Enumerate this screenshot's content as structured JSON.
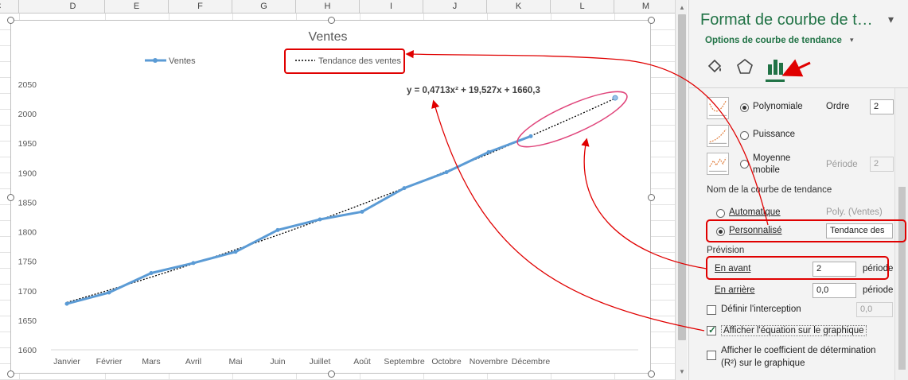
{
  "sheet": {
    "column_headers": [
      "C",
      "D",
      "E",
      "F",
      "G",
      "H",
      "I",
      "J",
      "K",
      "L",
      "M"
    ]
  },
  "chart_data": {
    "type": "line",
    "title": "Ventes",
    "categories": [
      "Janvier",
      "Février",
      "Mars",
      "Avril",
      "Mai",
      "Juin",
      "Juillet",
      "Août",
      "Septembre",
      "Octobre",
      "Novembre",
      "Décembre"
    ],
    "series": [
      {
        "name": "Ventes",
        "values": [
          1678,
          1697,
          1730,
          1747,
          1766,
          1803,
          1821,
          1834,
          1874,
          1901,
          1935,
          1962
        ],
        "color": "#5b9bd5"
      },
      {
        "name": "Tendance des ventes",
        "kind": "trendline",
        "style": "dotted",
        "color": "#000000"
      }
    ],
    "forecast_point": {
      "y": 2027
    },
    "yticks": [
      1600,
      1650,
      1700,
      1750,
      1800,
      1850,
      1900,
      1950,
      2000,
      2050
    ],
    "ylim": [
      1600,
      2050
    ],
    "equation_label": "y = 0,4713x² + 19,527x + 1660,3",
    "legend_position": "top",
    "grid": false
  },
  "pane": {
    "title": "Format de courbe de t…",
    "close": "▾",
    "subtitle": "Options de courbe de tendance",
    "subtitle_caret": "▾",
    "icons": [
      "fill-bucket-icon",
      "pentagon-effects-icon",
      "bar-chart-options-icon"
    ],
    "options": {
      "polynomiale": "Polynomiale",
      "ordre_label": "Ordre",
      "ordre_value": "2",
      "puissance": "Puissance",
      "moyenne_mobile_line1": "Moyenne",
      "moyenne_mobile_line2": "mobile",
      "periode_label": "Période",
      "periode_value": "2"
    },
    "name_section": {
      "heading": "Nom de la courbe de tendance",
      "automatique": "Automatique",
      "automatique_value": "Poly. (Ventes)",
      "personnalise": "Personnalisé",
      "personnalise_value": "Tendance des"
    },
    "forecast_section": {
      "heading": "Prévision",
      "en_avant": "En avant",
      "en_avant_value": "2",
      "en_avant_unit": "période",
      "en_arriere": "En arrière",
      "en_arriere_value": "0,0",
      "en_arriere_unit": "période"
    },
    "intercept": {
      "label": "Définir l'interception",
      "value": "0,0"
    },
    "show_equation": "Afficher l'équation sur le graphique",
    "show_r2_line1": "Afficher le coefficient de détermination",
    "show_r2_line2": "(R²) sur le graphique"
  },
  "colors": {
    "accent": "#217346",
    "series": "#5b9bd5",
    "annotation": "#e00000",
    "highlight_ellipse": "#e0457b"
  }
}
